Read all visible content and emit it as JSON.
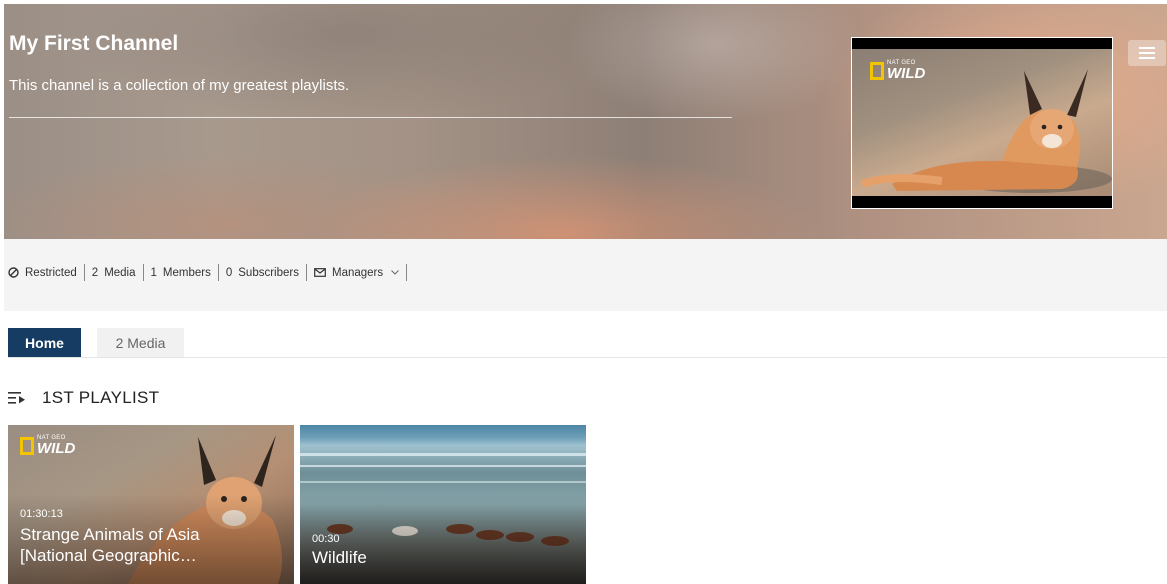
{
  "channel": {
    "title": "My First Channel",
    "description": "This channel is a collection of my greatest playlists.",
    "logo": {
      "small": "NAT GEO",
      "big": "WILD"
    }
  },
  "stats": {
    "restricted_label": "Restricted",
    "media_count": "2",
    "media_label": "Media",
    "members_count": "1",
    "members_label": "Members",
    "subscribers_count": "0",
    "subscribers_label": "Subscribers",
    "managers_label": "Managers"
  },
  "tabs": [
    {
      "label": "Home",
      "active": true
    },
    {
      "label": "2 Media",
      "active": false
    }
  ],
  "playlist": {
    "title": "1ST PLAYLIST",
    "items": [
      {
        "duration": "01:30:13",
        "title": "Strange Animals of Asia [National Geographic…",
        "logo": {
          "small": "NAT GEO",
          "big": "WILD"
        }
      },
      {
        "duration": "00:30",
        "title": "Wildlife"
      }
    ]
  },
  "colors": {
    "tab_active_bg": "#163c64",
    "stats_bg": "#f4f4f4",
    "logo_yellow": "#f2c500"
  }
}
